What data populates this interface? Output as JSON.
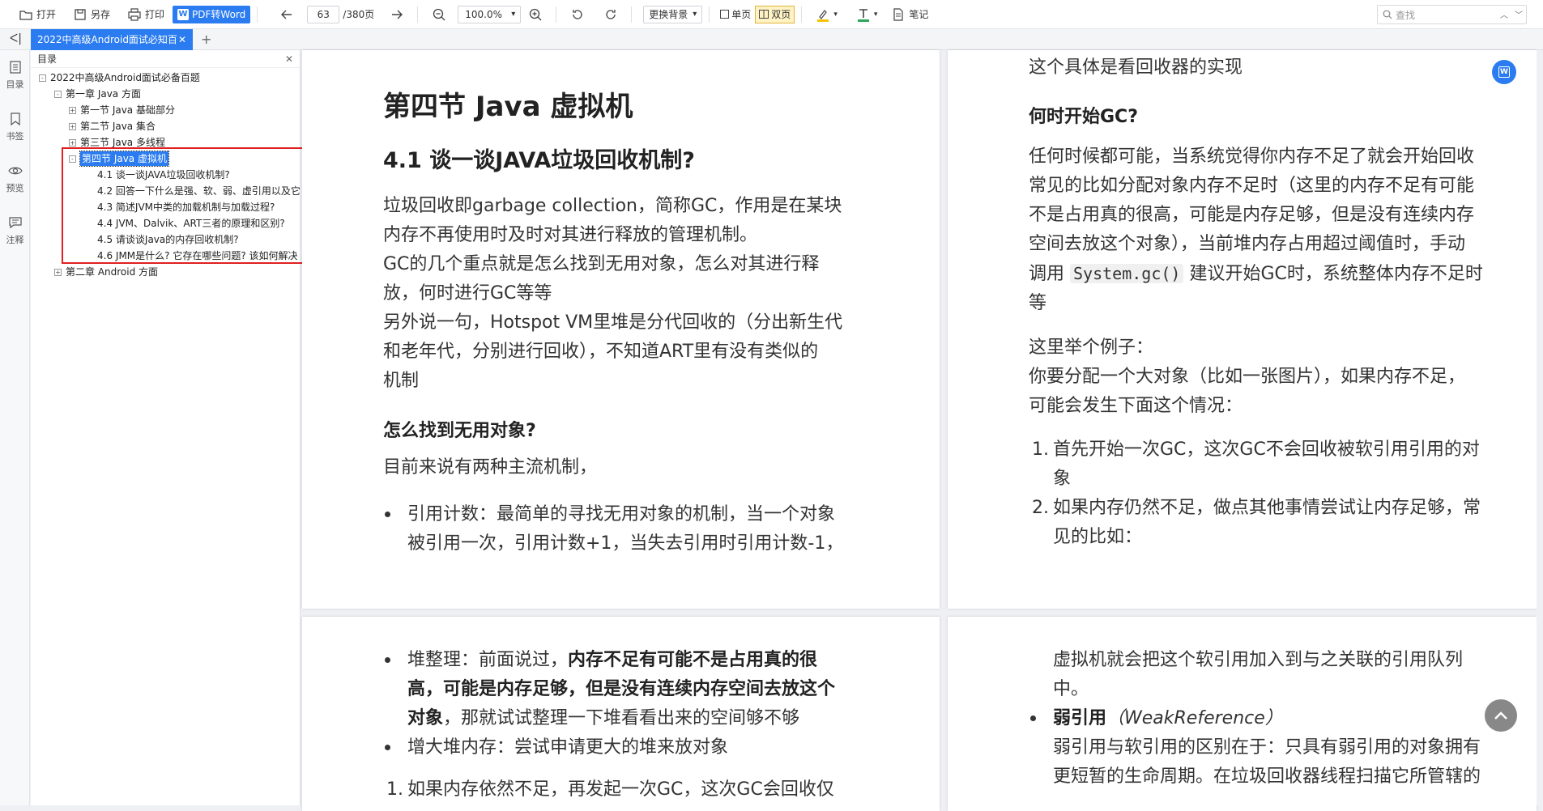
{
  "toolbar": {
    "open": "打开",
    "save_as": "另存",
    "print": "打印",
    "pdf_to_word": "PDF转Word",
    "page_current": "63",
    "page_total": "/380页",
    "zoom": "100.0%",
    "background": "更换背景",
    "single": "单页",
    "double": "双页",
    "notes": "笔记",
    "search_placeholder": "查找"
  },
  "tab": {
    "title": "2022中高级Android面试必知百"
  },
  "rail": {
    "toc": "目录",
    "bookmark": "书签",
    "preview": "预览",
    "annotation": "注释"
  },
  "toc": {
    "header": "目录",
    "items": [
      {
        "label": "2022中高级Android面试必备百题",
        "sign": "-"
      },
      {
        "label": "第一章 Java 方面",
        "sign": "-"
      },
      {
        "label": "第一节 Java 基础部分",
        "sign": "+"
      },
      {
        "label": "第二节 Java 集合",
        "sign": "+"
      },
      {
        "label": "第三节 Java 多线程",
        "sign": "+"
      },
      {
        "label": "第四节 Java 虚拟机",
        "sign": "-"
      },
      {
        "label": "4.1 谈一谈JAVA垃圾回收机制?"
      },
      {
        "label": "4.2 回答一下什么是强、软、弱、虚引用以及它"
      },
      {
        "label": "4.3 简述JVM中类的加载机制与加载过程?"
      },
      {
        "label": "4.4 JVM、Dalvik、ART三者的原理和区别?"
      },
      {
        "label": "4.5 请谈谈Java的内存回收机制?"
      },
      {
        "label": "4.6 JMM是什么? 它存在哪些问题? 该如何解决"
      },
      {
        "label": "第二章 Android 方面",
        "sign": "+"
      }
    ]
  },
  "page1": {
    "title": "第四节 Java 虚拟机",
    "h2": "4.1 谈一谈JAVA垃圾回收机制?",
    "lines": [
      "垃圾回收即garbage collection，简称GC，作用是在某块",
      "内存不再使用时及时对其进行释放的管理机制。",
      "GC的几个重点就是怎么找到无用对象，怎么对其进行释",
      "放，何时进行GC等等",
      "另外说一句，Hotspot VM里堆是分代回收的（分出新生代",
      "和老年代，分别进行回收），不知道ART里有没有类似的",
      "机制"
    ],
    "h3": "怎么找到无用对象?",
    "intro": "目前来说有两种主流机制，",
    "bullet1": [
      "引用计数：最简单的寻找无用对象的机制，当一个对象",
      "被引用一次，引用计数+1，当失去引用时引用计数-1，"
    ]
  },
  "page2": {
    "top": "这个具体是看回收器的实现",
    "h3": "何时开始GC?",
    "lines": [
      "任何时候都可能，当系统觉得你内存不足了就会开始回收",
      "常见的比如分配对象内存不足时（这里的内存不足有可能",
      "不是占用真的很高，可能是内存足够，但是没有连续内存",
      "空间去放这个对象），当前堆内存占用超过阈值时，手动"
    ],
    "line5_pre": "调用",
    "line5_code": "System.gc()",
    "line5_post": "建议开始GC时，系统整体内存不足时",
    "line6": "等",
    "ex1": "这里举个例子：",
    "ex2": "你要分配一个大对象（比如一张图片），如果内存不足，",
    "ex3": "可能会发生下面这个情况：",
    "n1_label": "1.",
    "n1": [
      "首先开始一次GC，这次GC不会回收被软引用引用的对",
      "象"
    ],
    "n2_label": "2.",
    "n2": [
      "如果内存仍然不足，做点其他事情尝试让内存足够，常",
      "见的比如："
    ]
  },
  "page3": {
    "b1_pre": "堆整理：前面说过，",
    "b1_bold1": "内存不足有可能不是占用真的很",
    "b1_bold2": "高，可能是内存足够，但是没有连续内存空间去放这个",
    "b1_bold3": "对象",
    "b1_post": "，那就试试整理一下堆看看出来的空间够不够",
    "b2": "增大堆内存：尝试申请更大的堆来放对象",
    "n1_label": "1.",
    "n1": "如果内存依然不足，再发起一次GC，这次GC会回收仅"
  },
  "page4": {
    "l1": "虚拟机就会把这个软引用加入到与之关联的引用队列",
    "l2": "中。",
    "b_bold": "弱引用",
    "b_italic": "（WeakReference）",
    "l3": "弱引用与软引用的区别在于：只具有弱引用的对象拥有",
    "l4": "更短暂的生命周期。在垃圾回收器线程扫描它所管辖的"
  },
  "colors": {
    "accent": "#2b7cf0",
    "highlight": "#e02020"
  }
}
